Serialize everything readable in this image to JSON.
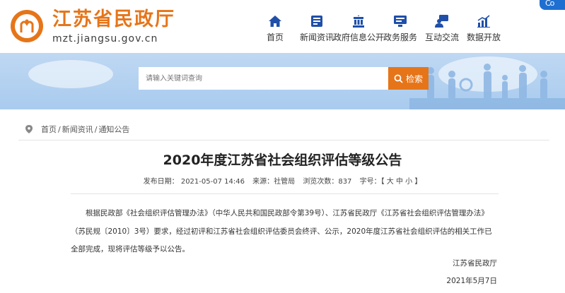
{
  "header": {
    "site_title": "江苏省民政厅",
    "site_url": "mzt.jiangsu.gov.cn",
    "corner_badge": "Co"
  },
  "nav": {
    "items": [
      {
        "label": "首页",
        "icon": "home-icon"
      },
      {
        "label": "新闻资讯",
        "icon": "news-icon"
      },
      {
        "label": "政府信息公开",
        "icon": "info-disclosure-icon"
      },
      {
        "label": "政务服务",
        "icon": "government-service-icon"
      },
      {
        "label": "互动交流",
        "icon": "interaction-icon"
      },
      {
        "label": "数据开放",
        "icon": "data-open-icon"
      }
    ]
  },
  "search": {
    "placeholder": "请输入关键词查询",
    "button_label": "检索"
  },
  "breadcrumb": {
    "items": [
      "首页",
      "新闻资讯",
      "通知公告"
    ]
  },
  "article": {
    "title": "2020年度江苏省社会组织评估等级公告",
    "meta": {
      "publish_date": "发布日期： 2021-05-07 14:46",
      "source": "来源：社管局",
      "views": "浏览次数：837",
      "font_size": "字号：【 大 中 小 】"
    },
    "body": "根据民政部《社会组织评估管理办法》（中华人民共和国民政部令第39号）、江苏省民政厅《江苏省社会组织评估管理办法》（苏民规〔2010〕3号）要求，经过初评和江苏省社会组织评估委员会终评、公示，2020年度江苏省社会组织评估的相关工作已全部完成，现将评估等级予以公告。",
    "sign_org": "江苏省民政厅",
    "sign_date": "2021年5月7日"
  },
  "colors": {
    "brand_orange": "#e67519",
    "nav_blue": "#1f6fd1",
    "banner_blue": "#b4d2f1"
  }
}
